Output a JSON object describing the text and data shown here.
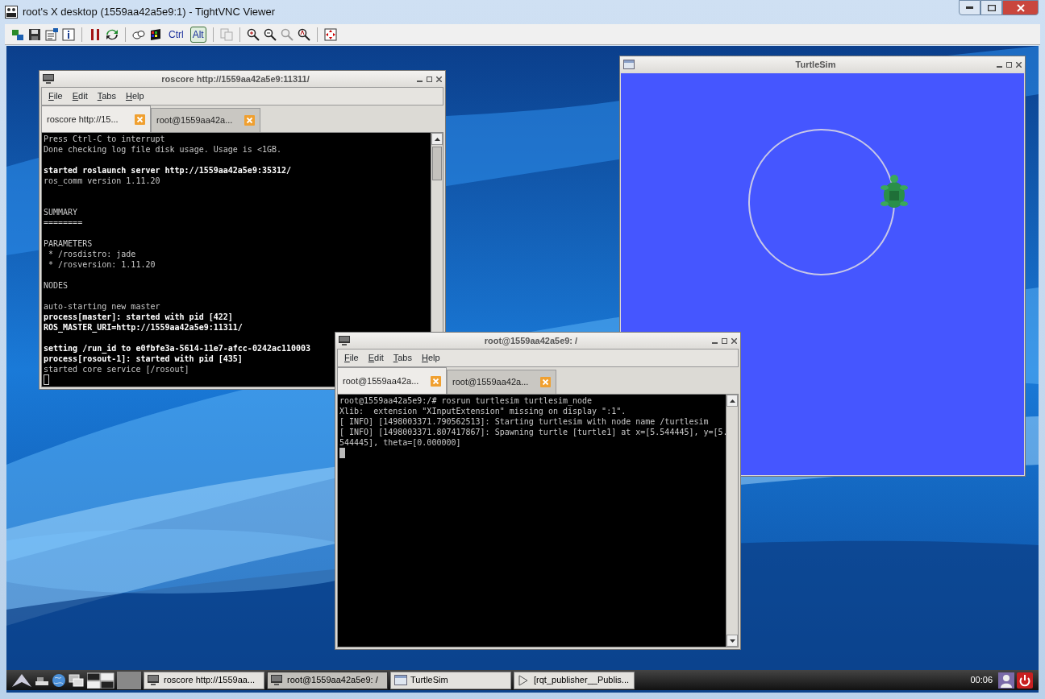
{
  "window": {
    "title": "root's X desktop (1559aa42a5e9:1) - TightVNC Viewer"
  },
  "toolbar": {
    "keys": [
      {
        "label": "Ctrl",
        "pressed": false
      },
      {
        "label": "Alt",
        "pressed": true
      }
    ]
  },
  "terminals": [
    {
      "title": "roscore http://1559aa42a5e9:11311/",
      "menu": [
        "File",
        "Edit",
        "Tabs",
        "Help"
      ],
      "cursor_focused": false,
      "tabs": [
        {
          "label": "roscore http://15...",
          "selected": true
        },
        {
          "label": "root@1559aa42a...",
          "selected": false
        }
      ],
      "lines": [
        {
          "text": "Press Ctrl-C to interrupt",
          "bold": false
        },
        {
          "text": "Done checking log file disk usage. Usage is <1GB.",
          "bold": false
        },
        {
          "kind": "blank"
        },
        {
          "text": "started roslaunch server http://1559aa42a5e9:35312/",
          "bold": true
        },
        {
          "text": "ros_comm version 1.11.20",
          "bold": false
        },
        {
          "kind": "blank"
        },
        {
          "kind": "blank"
        },
        {
          "text": "SUMMARY",
          "bold": false
        },
        {
          "text": "========",
          "bold": false
        },
        {
          "kind": "blank"
        },
        {
          "text": "PARAMETERS",
          "bold": false
        },
        {
          "text": " * /rosdistro: jade",
          "bold": false
        },
        {
          "text": " * /rosversion: 1.11.20",
          "bold": false
        },
        {
          "kind": "blank"
        },
        {
          "text": "NODES",
          "bold": false
        },
        {
          "kind": "blank"
        },
        {
          "text": "auto-starting new master",
          "bold": false
        },
        {
          "text": "process[master]: started with pid [422]",
          "bold": true
        },
        {
          "text": "ROS_MASTER_URI=http://1559aa42a5e9:11311/",
          "bold": true
        },
        {
          "kind": "blank"
        },
        {
          "text": "setting /run_id to e0fbfe3a-5614-11e7-afcc-0242ac110003",
          "bold": true
        },
        {
          "text": "process[rosout-1]: started with pid [435]",
          "bold": true
        },
        {
          "text": "started core service [/rosout]",
          "bold": false
        }
      ]
    },
    {
      "title": "root@1559aa42a5e9: /",
      "menu": [
        "File",
        "Edit",
        "Tabs",
        "Help"
      ],
      "cursor_focused": true,
      "tabs": [
        {
          "label": "root@1559aa42a...",
          "selected": true
        },
        {
          "label": "root@1559aa42a...",
          "selected": false
        }
      ],
      "lines": [
        {
          "text": "root@1559aa42a5e9:/# rosrun turtlesim turtlesim_node",
          "bold": false
        },
        {
          "text": "Xlib:  extension \"XInputExtension\" missing on display \":1\".",
          "bold": false
        },
        {
          "text": "[ INFO] [1498003371.790562513]: Starting turtlesim with node name /turtlesim",
          "bold": false
        },
        {
          "text": "[ INFO] [1498003371.807417867]: Spawning turtle [turtle1] at x=[5.544445], y=[5.",
          "bold": false
        },
        {
          "text": "544445], theta=[0.000000]",
          "bold": false
        }
      ]
    }
  ],
  "turtlesim": {
    "title": "TurtleSim"
  },
  "taskbar": {
    "items": [
      {
        "label": "roscore http://1559aa...",
        "kind": "terminal",
        "selected": false
      },
      {
        "label": "root@1559aa42a5e9: /",
        "kind": "terminal",
        "selected": true
      },
      {
        "label": "TurtleSim",
        "kind": "app",
        "selected": false
      },
      {
        "label": "[rqt_publisher__Publis...",
        "kind": "play",
        "selected": false
      }
    ],
    "clock": "00:06"
  }
}
